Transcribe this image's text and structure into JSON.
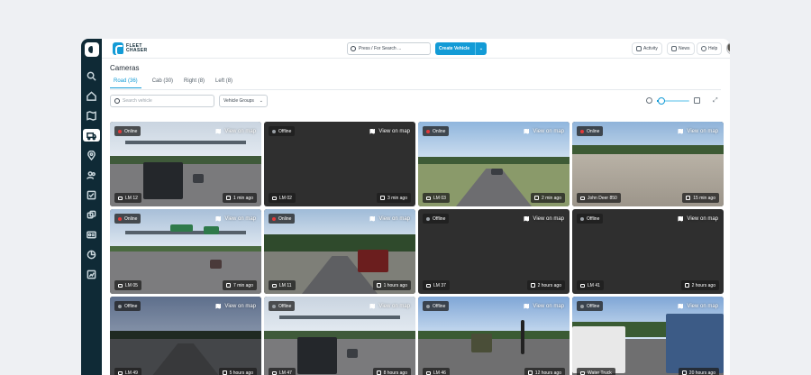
{
  "brand": {
    "line1": "FLEET",
    "line2": "CHASER"
  },
  "search": {
    "placeholder": "Press / For Search ..."
  },
  "create_button": {
    "label": "Create Vehicle",
    "chevron": "⌄"
  },
  "header_links": [
    {
      "label": "Activity",
      "icon": "bell-icon"
    },
    {
      "label": "News",
      "icon": "chat-icon"
    },
    {
      "label": "Help",
      "icon": "help-icon"
    }
  ],
  "page": {
    "title": "Cameras"
  },
  "tabs": [
    {
      "label": "Road (36)",
      "active": true
    },
    {
      "label": "Cab (30)",
      "active": false
    },
    {
      "label": "Right (8)",
      "active": false
    },
    {
      "label": "Left (8)",
      "active": false
    }
  ],
  "filters": {
    "search_placeholder": "Search vehicle",
    "groups_label": "Vehicle Groups",
    "groups_chevron": "⌄"
  },
  "grid_zoom_percent": 15,
  "expand_glyph": "⤢",
  "view_on_map_label": "View on map",
  "cameras": [
    {
      "status": "Online",
      "vehicle": "LM 12",
      "time": "1 min ago",
      "scene": "highway-truck"
    },
    {
      "status": "Offline",
      "vehicle": "LM 02",
      "time": "3 min ago",
      "scene": "dark"
    },
    {
      "status": "Online",
      "vehicle": "LM 03",
      "time": "2 min ago",
      "scene": "highway"
    },
    {
      "status": "Online",
      "vehicle": "John Deer 850",
      "time": "15 min ago",
      "scene": "gravel"
    },
    {
      "status": "Online",
      "vehicle": "LM 05",
      "time": "7 min ago",
      "scene": "highway-signs"
    },
    {
      "status": "Online",
      "vehicle": "LM 11",
      "time": "1 hours ago",
      "scene": "rural-truck"
    },
    {
      "status": "Offline",
      "vehicle": "LM 37",
      "time": "2 hours ago",
      "scene": "dark"
    },
    {
      "status": "Offline",
      "vehicle": "LM 41",
      "time": "2 hours ago",
      "scene": "dark"
    },
    {
      "status": "Offline",
      "vehicle": "LM 49",
      "time": "5 hours ago",
      "scene": "dusk-highway"
    },
    {
      "status": "Offline",
      "vehicle": "LM 47",
      "time": "8 hours ago",
      "scene": "highway-truck"
    },
    {
      "status": "Offline",
      "vehicle": "LM 46",
      "time": "12 hours ago",
      "scene": "crossing"
    },
    {
      "status": "Offline",
      "vehicle": "Water Truck",
      "time": "20 hours ago",
      "scene": "dump-truck"
    }
  ],
  "colors": {
    "accent": "#139bd6",
    "sidebar": "#0f2a36",
    "online_dot": "#e23a3a",
    "offline_dot": "#9aa0a6"
  }
}
